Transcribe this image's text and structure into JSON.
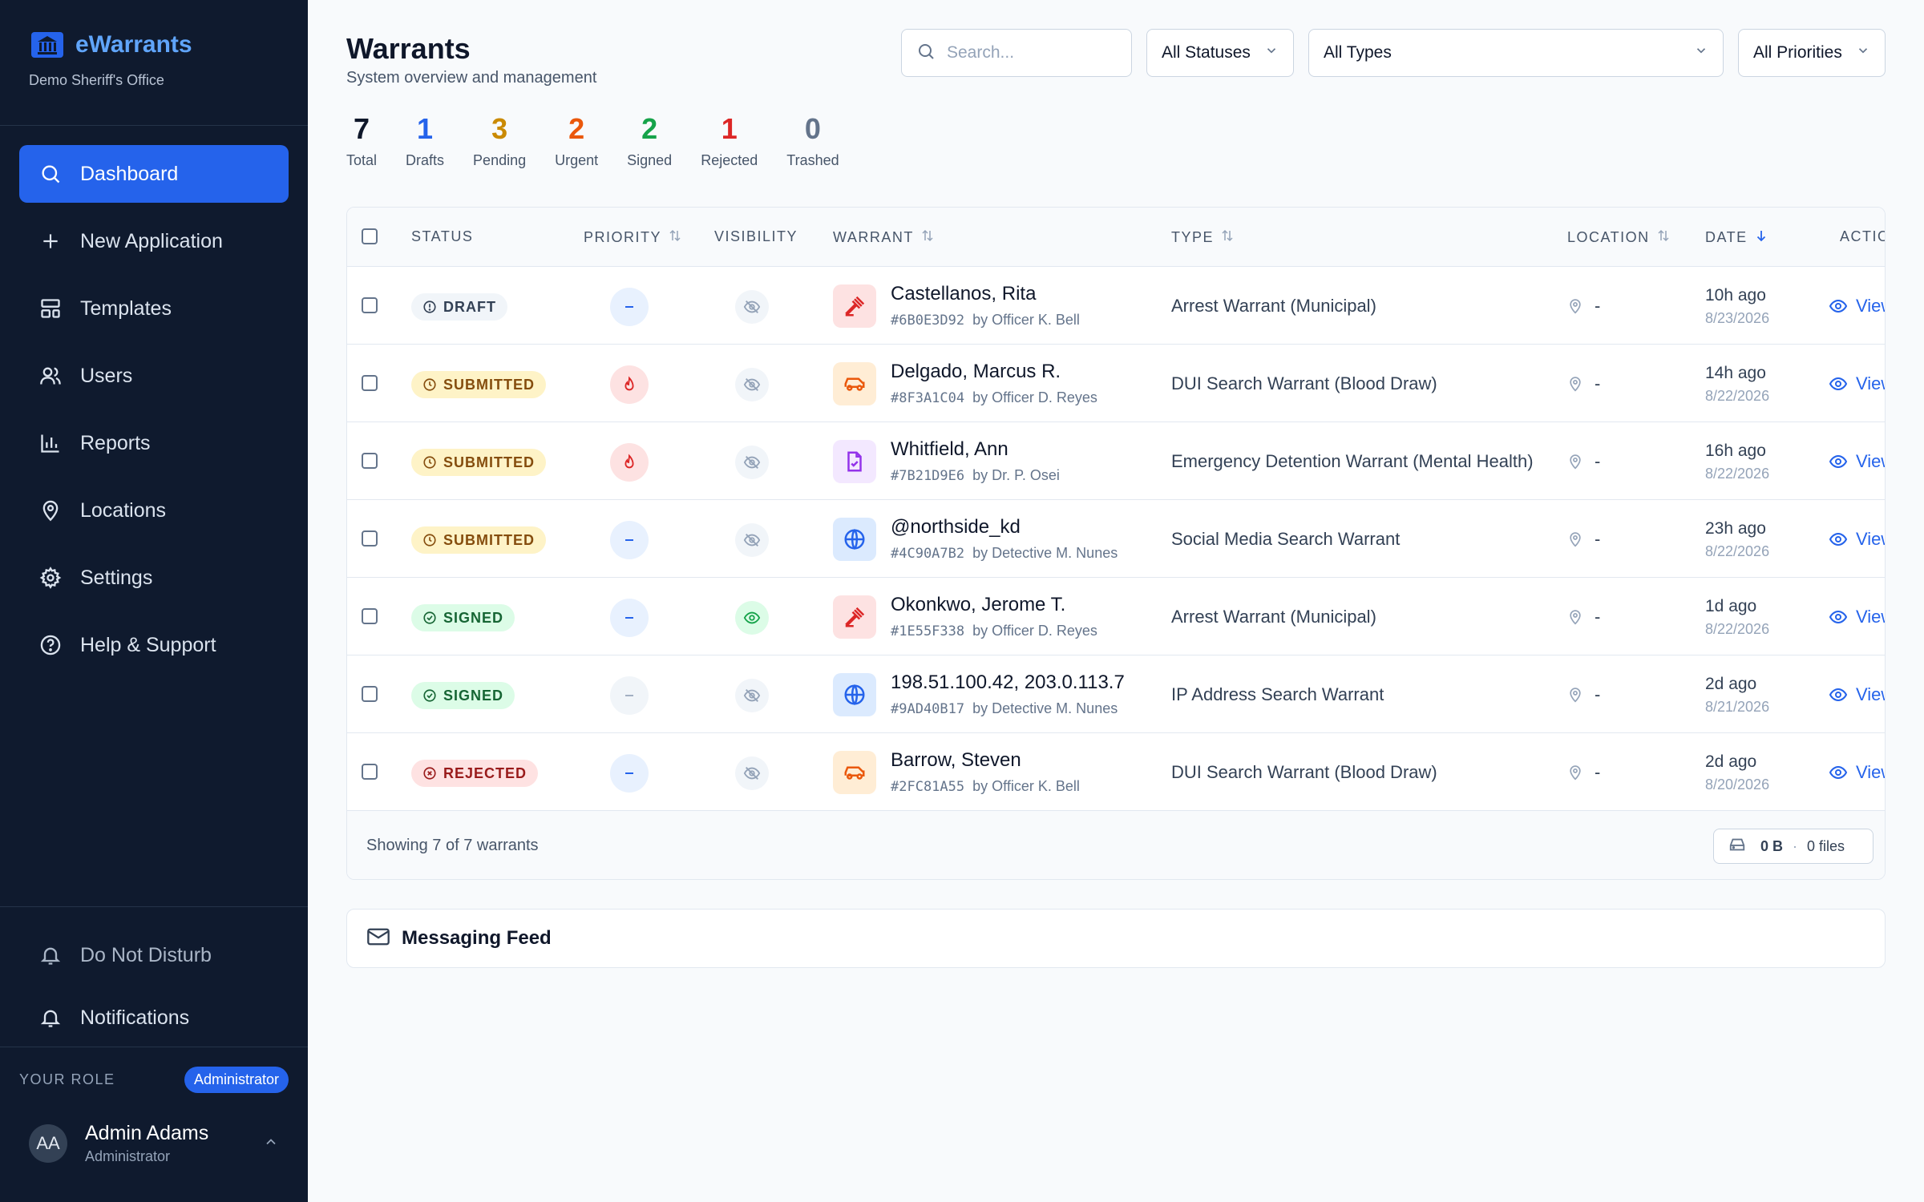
{
  "brand": {
    "name": "eWarrants",
    "subtitle": "Demo Sheriff's Office"
  },
  "nav": [
    {
      "label": "Dashboard",
      "icon": "search-icon",
      "active": true
    },
    {
      "label": "New Application",
      "icon": "plus-icon"
    },
    {
      "label": "Templates",
      "icon": "layout-icon"
    },
    {
      "label": "Users",
      "icon": "users-icon"
    },
    {
      "label": "Reports",
      "icon": "bar-chart-icon"
    },
    {
      "label": "Locations",
      "icon": "map-pin-icon"
    },
    {
      "label": "Settings",
      "icon": "gear-icon"
    },
    {
      "label": "Help & Support",
      "icon": "help-circle-icon"
    }
  ],
  "bottom_nav": [
    {
      "label": "Do Not Disturb",
      "icon": "bell-icon"
    },
    {
      "label": "Notifications",
      "icon": "bell-icon"
    }
  ],
  "role": {
    "label": "YOUR ROLE",
    "badge": "Administrator"
  },
  "user": {
    "initials": "AA",
    "name": "Admin Adams",
    "role": "Administrator"
  },
  "header": {
    "title": "Warrants",
    "subtitle": "System overview and management",
    "search_placeholder": "Search...",
    "filters": {
      "status": "All Statuses",
      "type": "All Types",
      "priority": "All Priorities"
    }
  },
  "stats": [
    {
      "value": "7",
      "label": "Total",
      "color": "#0f172a"
    },
    {
      "value": "1",
      "label": "Drafts",
      "color": "#2563eb"
    },
    {
      "value": "3",
      "label": "Pending",
      "color": "#ca8a04"
    },
    {
      "value": "2",
      "label": "Urgent",
      "color": "#ea580c"
    },
    {
      "value": "2",
      "label": "Signed",
      "color": "#16a34a"
    },
    {
      "value": "1",
      "label": "Rejected",
      "color": "#dc2626"
    },
    {
      "value": "0",
      "label": "Trashed",
      "color": "#64748b"
    }
  ],
  "table": {
    "columns": {
      "status": "STATUS",
      "priority": "PRIORITY",
      "visibility": "VISIBILITY",
      "warrant": "WARRANT",
      "type": "TYPE",
      "location": "LOCATION",
      "date": "DATE",
      "actions": "ACTIO"
    },
    "view_label": "View",
    "rows": [
      {
        "status": "DRAFT",
        "status_kind": "draft",
        "priority": "normal",
        "visible": false,
        "icon": "gavel-icon",
        "name": "Castellanos, Rita",
        "id": "#6B0E3D92",
        "by": "by Officer K. Bell",
        "type": "Arrest Warrant (Municipal)",
        "location": "-",
        "ago": "10h ago",
        "date": "8/23/2026"
      },
      {
        "status": "SUBMITTED",
        "status_kind": "submitted",
        "priority": "urgent",
        "visible": false,
        "icon": "car-icon",
        "name": "Delgado, Marcus R.",
        "id": "#8F3A1C04",
        "by": "by Officer D. Reyes",
        "type": "DUI Search Warrant (Blood Draw)",
        "location": "-",
        "ago": "14h ago",
        "date": "8/22/2026"
      },
      {
        "status": "SUBMITTED",
        "status_kind": "submitted",
        "priority": "urgent",
        "visible": false,
        "icon": "file-check-icon",
        "name": "Whitfield, Ann",
        "id": "#7B21D9E6",
        "by": "by Dr. P. Osei",
        "type": "Emergency Detention Warrant (Mental Health)",
        "location": "-",
        "ago": "16h ago",
        "date": "8/22/2026"
      },
      {
        "status": "SUBMITTED",
        "status_kind": "submitted",
        "priority": "normal",
        "visible": false,
        "icon": "globe-icon",
        "name": "@northside_kd",
        "id": "#4C90A7B2",
        "by": "by Detective M. Nunes",
        "type": "Social Media Search Warrant",
        "location": "-",
        "ago": "23h ago",
        "date": "8/22/2026"
      },
      {
        "status": "SIGNED",
        "status_kind": "signed",
        "priority": "normal",
        "visible": true,
        "icon": "gavel-icon",
        "name": "Okonkwo, Jerome T.",
        "id": "#1E55F338",
        "by": "by Officer D. Reyes",
        "type": "Arrest Warrant (Municipal)",
        "location": "-",
        "ago": "1d ago",
        "date": "8/22/2026"
      },
      {
        "status": "SIGNED",
        "status_kind": "signed",
        "priority": "low",
        "visible": false,
        "icon": "globe-icon",
        "name": "198.51.100.42, 203.0.113.7",
        "id": "#9AD40B17",
        "by": "by Detective M. Nunes",
        "type": "IP Address Search Warrant",
        "location": "-",
        "ago": "2d ago",
        "date": "8/21/2026"
      },
      {
        "status": "REJECTED",
        "status_kind": "rejected",
        "priority": "normal",
        "visible": false,
        "icon": "car-icon",
        "name": "Barrow, Steven",
        "id": "#2FC81A55",
        "by": "by Officer K. Bell",
        "type": "DUI Search Warrant (Blood Draw)",
        "location": "-",
        "ago": "2d ago",
        "date": "8/20/2026"
      }
    ],
    "footer": {
      "showing": "Showing 7 of 7 warrants",
      "size": "0 B",
      "files": "0 files"
    }
  },
  "messaging": {
    "title": "Messaging Feed"
  }
}
